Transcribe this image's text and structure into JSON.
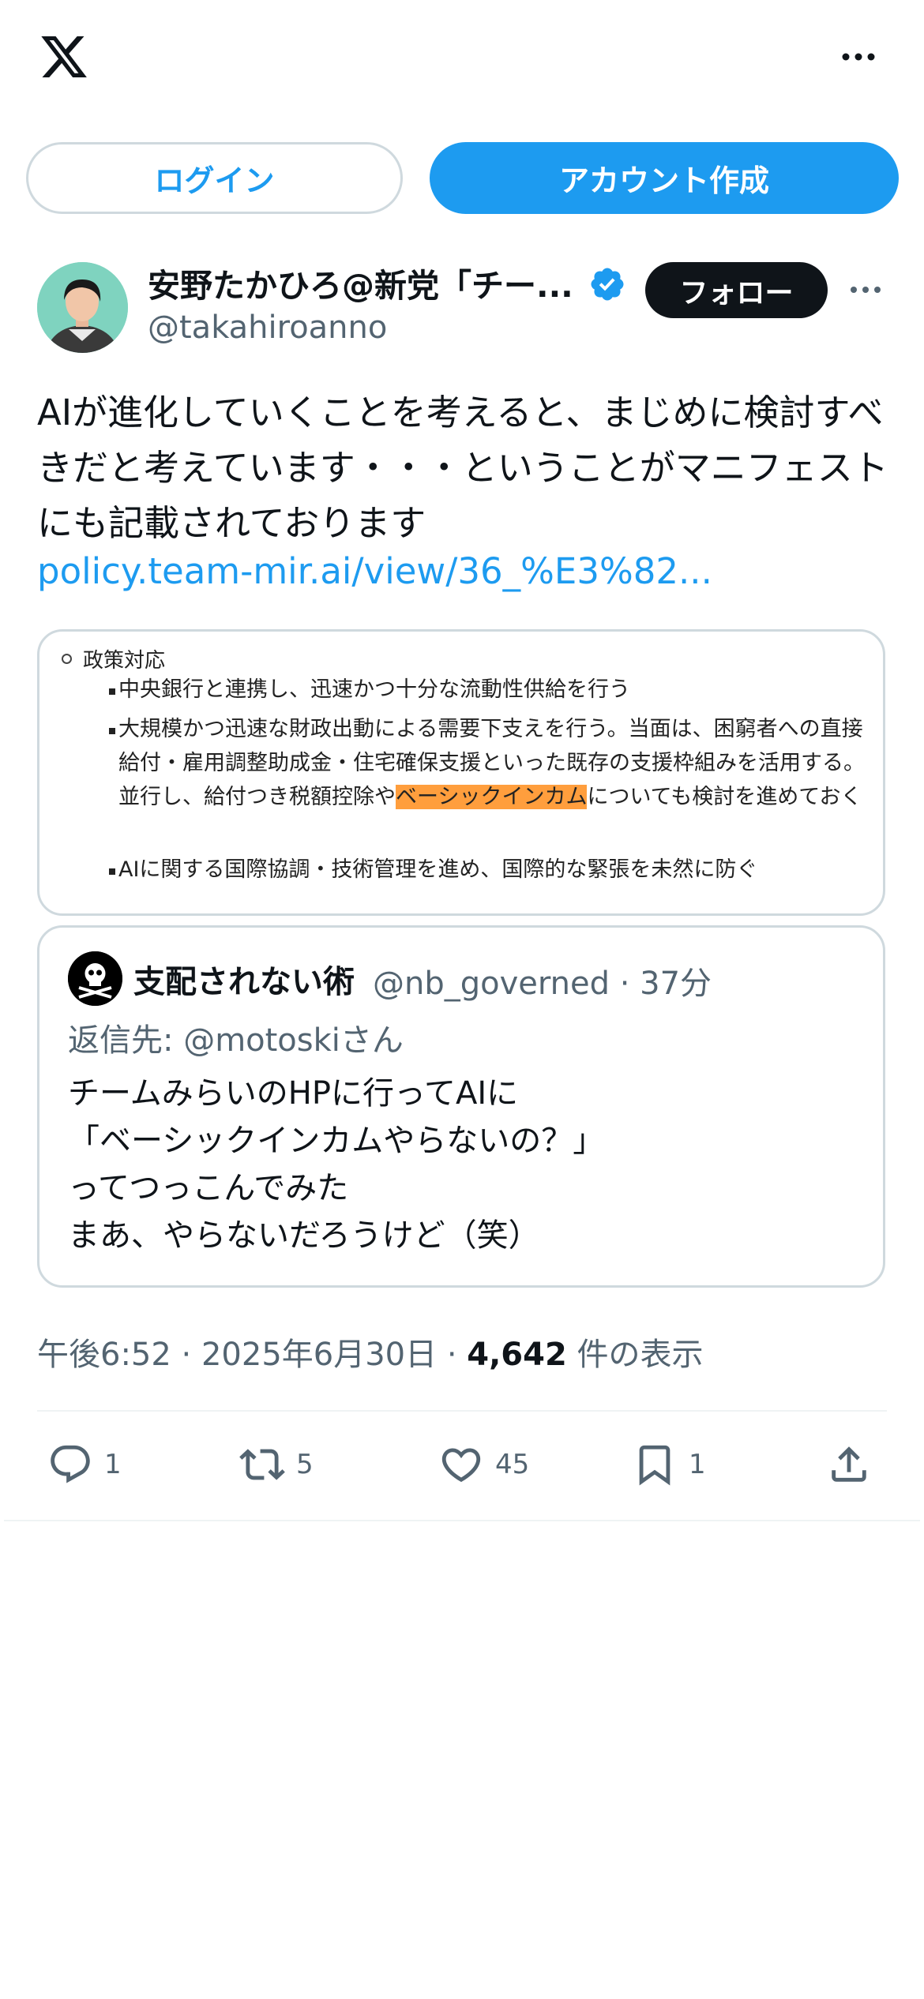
{
  "topbar": {
    "logo_icon": "x-logo-icon",
    "more_icon": "more-horizontal-icon"
  },
  "auth": {
    "login_label": "ログイン",
    "signup_label": "アカウント作成"
  },
  "author": {
    "name": "安野たかひろ@新党「チー...",
    "handle": "@takahiroanno",
    "verified_icon": "verified-badge-icon",
    "follow_label": "フォロー"
  },
  "tweet": {
    "text": "AIが進化していくことを考えると、まじめに検討すべきだと考えています・・・ということがマニフェストにも記載されております",
    "link": "policy.team-mir.ai/view/36_%E3%82..."
  },
  "media": {
    "heading": "政策対応",
    "items": [
      "中央銀行と連携し、迅速かつ十分な流動性供給を行う",
      "大規模かつ迅速な財政出動による需要下支えを行う。当面は、困窮者への直接給付・雇用調整助成金・住宅確保支援といった既存の支援枠組みを活用する。並行し、給付つき税額控除や",
      "ベーシックインカム",
      "についても検討を進めておく",
      "AIに関する国際協調・技術管理を進め、国際的な緊張を未然に防ぐ"
    ],
    "highlight_color": "#ff9e3d"
  },
  "quote": {
    "name": "支配されない術",
    "meta": "@nb_governed · 37分",
    "reply_to": "返信先: @motoskiさん",
    "lines": [
      "チームみらいのHPに行ってAIに",
      "「ベーシックインカムやらないの？」",
      "ってつっこんでみた",
      "まあ、やらないだろうけど（笑）"
    ]
  },
  "meta": {
    "time": "午後6:52 · 2025年6月30日 · ",
    "views_count": "4,642",
    "views_label": " 件の表示"
  },
  "actions": {
    "reply_count": "1",
    "retweet_count": "5",
    "like_count": "45",
    "bookmark_count": "1"
  },
  "colors": {
    "accent": "#1d9bf0",
    "text": "#0f1419",
    "secondary": "#536471",
    "border": "#cfd9de"
  }
}
